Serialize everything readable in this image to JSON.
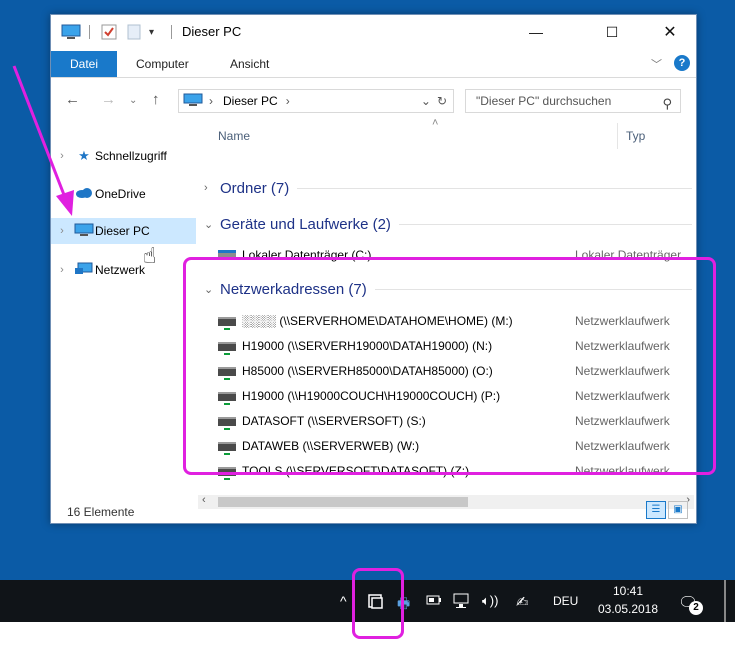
{
  "window": {
    "title": "Dieser PC",
    "tabs": [
      "Datei",
      "Computer",
      "Ansicht"
    ],
    "address": [
      "Dieser PC"
    ],
    "search_placeholder": "\"Dieser PC\" durchsuchen"
  },
  "navpane": {
    "items": [
      {
        "label": "Schnellzugriff",
        "icon": "star-icon"
      },
      {
        "label": "OneDrive",
        "icon": "cloud-icon"
      },
      {
        "label": "Dieser PC",
        "icon": "computer-icon",
        "selected": true
      },
      {
        "label": "Netzwerk",
        "icon": "network-icon"
      }
    ]
  },
  "columns": {
    "name": "Name",
    "type": "Typ"
  },
  "groups": {
    "folders": "Ordner (7)",
    "devices": "Geräte und Laufwerke (2)",
    "network": "Netzwerkadressen (7)"
  },
  "devices": [
    {
      "name": "Lokaler Datenträger (C:)",
      "type": "Lokaler Datenträger"
    }
  ],
  "network_drives": [
    {
      "name": "░░░░ (\\\\SERVERHOME\\DATAHOME\\HOME) (M:)",
      "type": "Netzwerklaufwerk"
    },
    {
      "name": "H19000 (\\\\SERVERH19000\\DATAH19000) (N:)",
      "type": "Netzwerklaufwerk"
    },
    {
      "name": "H85000 (\\\\SERVERH85000\\DATAH85000) (O:)",
      "type": "Netzwerklaufwerk"
    },
    {
      "name": "H19000 (\\\\H19000COUCH\\H19000COUCH) (P:)",
      "type": "Netzwerklaufwerk"
    },
    {
      "name": "DATASOFT (\\\\SERVERSOFT) (S:)",
      "type": "Netzwerklaufwerk"
    },
    {
      "name": "DATAWEB (\\\\SERVERWEB) (W:)",
      "type": "Netzwerklaufwerk"
    },
    {
      "name": "TOOLS (\\\\SERVERSOFT\\DATASOFT) (Z:)",
      "type": "Netzwerklaufwerk"
    }
  ],
  "status": {
    "count": "16 Elemente"
  },
  "taskbar": {
    "language": "DEU",
    "time": "10:41",
    "date": "03.05.2018",
    "notifications": "2"
  },
  "colors": {
    "desktop": "#0b5ba6",
    "accent": "#1979ca",
    "annotation": "#e020e0",
    "group_heading": "#1e3287"
  }
}
